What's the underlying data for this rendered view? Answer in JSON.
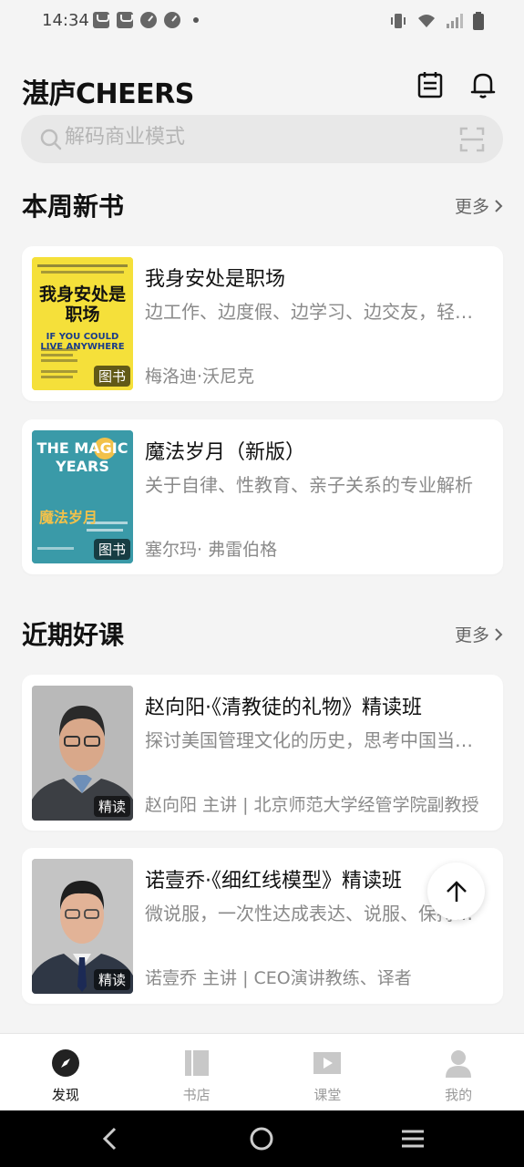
{
  "status": {
    "time": "14:34"
  },
  "header": {
    "logo": "湛庐CHEERS",
    "calendar_icon": "calendar-icon",
    "bell_icon": "bell-icon"
  },
  "search": {
    "placeholder": "解码商业模式"
  },
  "new_books": {
    "title": "本周新书",
    "more": "更多",
    "items": [
      {
        "title": "我身安处是职场",
        "desc": "边工作、边度假、边学习、边交友，轻松工作",
        "author": "梅洛迪·沃尼克",
        "tag": "图书",
        "cover_text_cn": "我身安处是职场",
        "cover_text_en": "IF YOU COULD LIVE ANYWHERE"
      },
      {
        "title": "魔法岁月（新版）",
        "desc": "关于自律、性教育、亲子关系的专业解析",
        "author": "塞尔玛· 弗雷伯格",
        "tag": "图书",
        "cover_text_en": "THE MAGIC YEARS",
        "cover_text_cn": "魔法岁月"
      }
    ]
  },
  "courses": {
    "title": "近期好课",
    "more": "更多",
    "items": [
      {
        "title": "赵向阳·《清教徒的礼物》精读班",
        "desc": "探讨美国管理文化的历史，思考中国当下的管理问题",
        "author": "赵向阳 主讲 | 北京师范大学经管学院副教授",
        "tag": "精读"
      },
      {
        "title": "诺壹乔·《细红线模型》精读班",
        "desc": "微说服，一次性达成表达、说服、保持信任",
        "author": "诺壹乔 主讲 | CEO演讲教练、译者",
        "tag": "精读"
      }
    ]
  },
  "bottom_nav": [
    {
      "label": "发现",
      "icon": "compass-icon",
      "active": true
    },
    {
      "label": "书店",
      "icon": "books-icon",
      "active": false
    },
    {
      "label": "课堂",
      "icon": "play-icon",
      "active": false
    },
    {
      "label": "我的",
      "icon": "person-icon",
      "active": false
    }
  ],
  "colors": {
    "background": "#f4f4f4",
    "card": "#ffffff",
    "text_primary": "#111111",
    "text_secondary": "#8a8a8a"
  }
}
